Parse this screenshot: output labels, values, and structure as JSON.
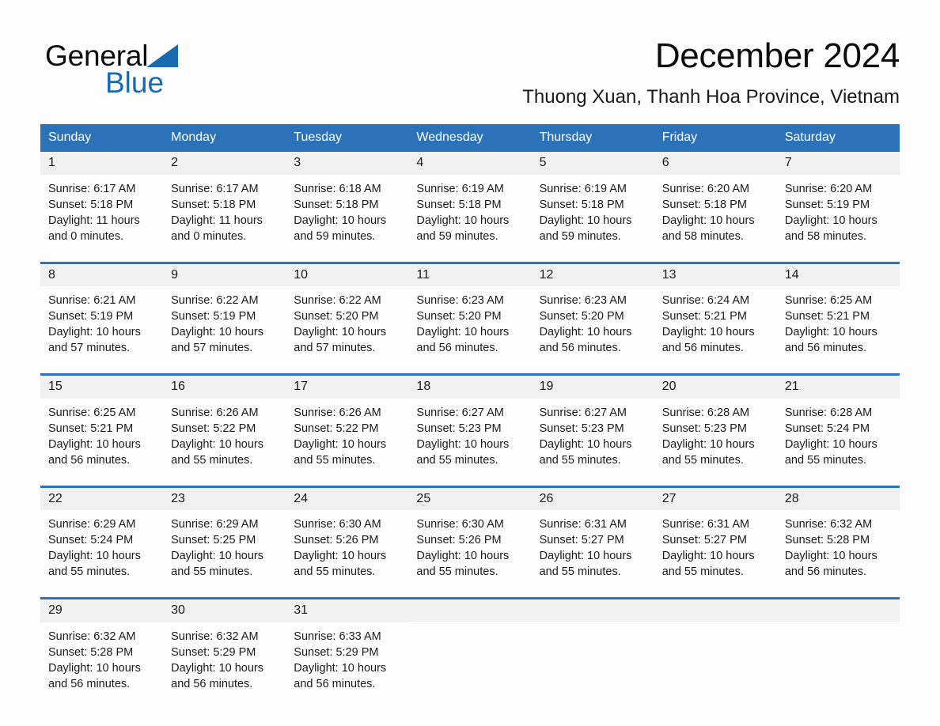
{
  "logo": {
    "text_dark": "General",
    "text_blue": "Blue",
    "triangle_color": "#1769b0"
  },
  "header": {
    "title": "December 2024",
    "subtitle": "Thuong Xuan, Thanh Hoa Province, Vietnam"
  },
  "theme": {
    "header_bg": "#2c72b8",
    "header_text": "#ffffff",
    "daynum_bg": "#f0f0f0",
    "page_bg": "#fdfdfd",
    "body_text": "#1a1a1a"
  },
  "calendar": {
    "weekday_headers": [
      "Sunday",
      "Monday",
      "Tuesday",
      "Wednesday",
      "Thursday",
      "Friday",
      "Saturday"
    ],
    "weeks": [
      [
        {
          "day": "1",
          "sunrise": "Sunrise: 6:17 AM",
          "sunset": "Sunset: 5:18 PM",
          "daylight_1": "Daylight: 11 hours",
          "daylight_2": "and 0 minutes."
        },
        {
          "day": "2",
          "sunrise": "Sunrise: 6:17 AM",
          "sunset": "Sunset: 5:18 PM",
          "daylight_1": "Daylight: 11 hours",
          "daylight_2": "and 0 minutes."
        },
        {
          "day": "3",
          "sunrise": "Sunrise: 6:18 AM",
          "sunset": "Sunset: 5:18 PM",
          "daylight_1": "Daylight: 10 hours",
          "daylight_2": "and 59 minutes."
        },
        {
          "day": "4",
          "sunrise": "Sunrise: 6:19 AM",
          "sunset": "Sunset: 5:18 PM",
          "daylight_1": "Daylight: 10 hours",
          "daylight_2": "and 59 minutes."
        },
        {
          "day": "5",
          "sunrise": "Sunrise: 6:19 AM",
          "sunset": "Sunset: 5:18 PM",
          "daylight_1": "Daylight: 10 hours",
          "daylight_2": "and 59 minutes."
        },
        {
          "day": "6",
          "sunrise": "Sunrise: 6:20 AM",
          "sunset": "Sunset: 5:18 PM",
          "daylight_1": "Daylight: 10 hours",
          "daylight_2": "and 58 minutes."
        },
        {
          "day": "7",
          "sunrise": "Sunrise: 6:20 AM",
          "sunset": "Sunset: 5:19 PM",
          "daylight_1": "Daylight: 10 hours",
          "daylight_2": "and 58 minutes."
        }
      ],
      [
        {
          "day": "8",
          "sunrise": "Sunrise: 6:21 AM",
          "sunset": "Sunset: 5:19 PM",
          "daylight_1": "Daylight: 10 hours",
          "daylight_2": "and 57 minutes."
        },
        {
          "day": "9",
          "sunrise": "Sunrise: 6:22 AM",
          "sunset": "Sunset: 5:19 PM",
          "daylight_1": "Daylight: 10 hours",
          "daylight_2": "and 57 minutes."
        },
        {
          "day": "10",
          "sunrise": "Sunrise: 6:22 AM",
          "sunset": "Sunset: 5:20 PM",
          "daylight_1": "Daylight: 10 hours",
          "daylight_2": "and 57 minutes."
        },
        {
          "day": "11",
          "sunrise": "Sunrise: 6:23 AM",
          "sunset": "Sunset: 5:20 PM",
          "daylight_1": "Daylight: 10 hours",
          "daylight_2": "and 56 minutes."
        },
        {
          "day": "12",
          "sunrise": "Sunrise: 6:23 AM",
          "sunset": "Sunset: 5:20 PM",
          "daylight_1": "Daylight: 10 hours",
          "daylight_2": "and 56 minutes."
        },
        {
          "day": "13",
          "sunrise": "Sunrise: 6:24 AM",
          "sunset": "Sunset: 5:21 PM",
          "daylight_1": "Daylight: 10 hours",
          "daylight_2": "and 56 minutes."
        },
        {
          "day": "14",
          "sunrise": "Sunrise: 6:25 AM",
          "sunset": "Sunset: 5:21 PM",
          "daylight_1": "Daylight: 10 hours",
          "daylight_2": "and 56 minutes."
        }
      ],
      [
        {
          "day": "15",
          "sunrise": "Sunrise: 6:25 AM",
          "sunset": "Sunset: 5:21 PM",
          "daylight_1": "Daylight: 10 hours",
          "daylight_2": "and 56 minutes."
        },
        {
          "day": "16",
          "sunrise": "Sunrise: 6:26 AM",
          "sunset": "Sunset: 5:22 PM",
          "daylight_1": "Daylight: 10 hours",
          "daylight_2": "and 55 minutes."
        },
        {
          "day": "17",
          "sunrise": "Sunrise: 6:26 AM",
          "sunset": "Sunset: 5:22 PM",
          "daylight_1": "Daylight: 10 hours",
          "daylight_2": "and 55 minutes."
        },
        {
          "day": "18",
          "sunrise": "Sunrise: 6:27 AM",
          "sunset": "Sunset: 5:23 PM",
          "daylight_1": "Daylight: 10 hours",
          "daylight_2": "and 55 minutes."
        },
        {
          "day": "19",
          "sunrise": "Sunrise: 6:27 AM",
          "sunset": "Sunset: 5:23 PM",
          "daylight_1": "Daylight: 10 hours",
          "daylight_2": "and 55 minutes."
        },
        {
          "day": "20",
          "sunrise": "Sunrise: 6:28 AM",
          "sunset": "Sunset: 5:23 PM",
          "daylight_1": "Daylight: 10 hours",
          "daylight_2": "and 55 minutes."
        },
        {
          "day": "21",
          "sunrise": "Sunrise: 6:28 AM",
          "sunset": "Sunset: 5:24 PM",
          "daylight_1": "Daylight: 10 hours",
          "daylight_2": "and 55 minutes."
        }
      ],
      [
        {
          "day": "22",
          "sunrise": "Sunrise: 6:29 AM",
          "sunset": "Sunset: 5:24 PM",
          "daylight_1": "Daylight: 10 hours",
          "daylight_2": "and 55 minutes."
        },
        {
          "day": "23",
          "sunrise": "Sunrise: 6:29 AM",
          "sunset": "Sunset: 5:25 PM",
          "daylight_1": "Daylight: 10 hours",
          "daylight_2": "and 55 minutes."
        },
        {
          "day": "24",
          "sunrise": "Sunrise: 6:30 AM",
          "sunset": "Sunset: 5:26 PM",
          "daylight_1": "Daylight: 10 hours",
          "daylight_2": "and 55 minutes."
        },
        {
          "day": "25",
          "sunrise": "Sunrise: 6:30 AM",
          "sunset": "Sunset: 5:26 PM",
          "daylight_1": "Daylight: 10 hours",
          "daylight_2": "and 55 minutes."
        },
        {
          "day": "26",
          "sunrise": "Sunrise: 6:31 AM",
          "sunset": "Sunset: 5:27 PM",
          "daylight_1": "Daylight: 10 hours",
          "daylight_2": "and 55 minutes."
        },
        {
          "day": "27",
          "sunrise": "Sunrise: 6:31 AM",
          "sunset": "Sunset: 5:27 PM",
          "daylight_1": "Daylight: 10 hours",
          "daylight_2": "and 55 minutes."
        },
        {
          "day": "28",
          "sunrise": "Sunrise: 6:32 AM",
          "sunset": "Sunset: 5:28 PM",
          "daylight_1": "Daylight: 10 hours",
          "daylight_2": "and 56 minutes."
        }
      ],
      [
        {
          "day": "29",
          "sunrise": "Sunrise: 6:32 AM",
          "sunset": "Sunset: 5:28 PM",
          "daylight_1": "Daylight: 10 hours",
          "daylight_2": "and 56 minutes."
        },
        {
          "day": "30",
          "sunrise": "Sunrise: 6:32 AM",
          "sunset": "Sunset: 5:29 PM",
          "daylight_1": "Daylight: 10 hours",
          "daylight_2": "and 56 minutes."
        },
        {
          "day": "31",
          "sunrise": "Sunrise: 6:33 AM",
          "sunset": "Sunset: 5:29 PM",
          "daylight_1": "Daylight: 10 hours",
          "daylight_2": "and 56 minutes."
        },
        {
          "day": "",
          "sunrise": "",
          "sunset": "",
          "daylight_1": "",
          "daylight_2": ""
        },
        {
          "day": "",
          "sunrise": "",
          "sunset": "",
          "daylight_1": "",
          "daylight_2": ""
        },
        {
          "day": "",
          "sunrise": "",
          "sunset": "",
          "daylight_1": "",
          "daylight_2": ""
        },
        {
          "day": "",
          "sunrise": "",
          "sunset": "",
          "daylight_1": "",
          "daylight_2": ""
        }
      ]
    ]
  }
}
